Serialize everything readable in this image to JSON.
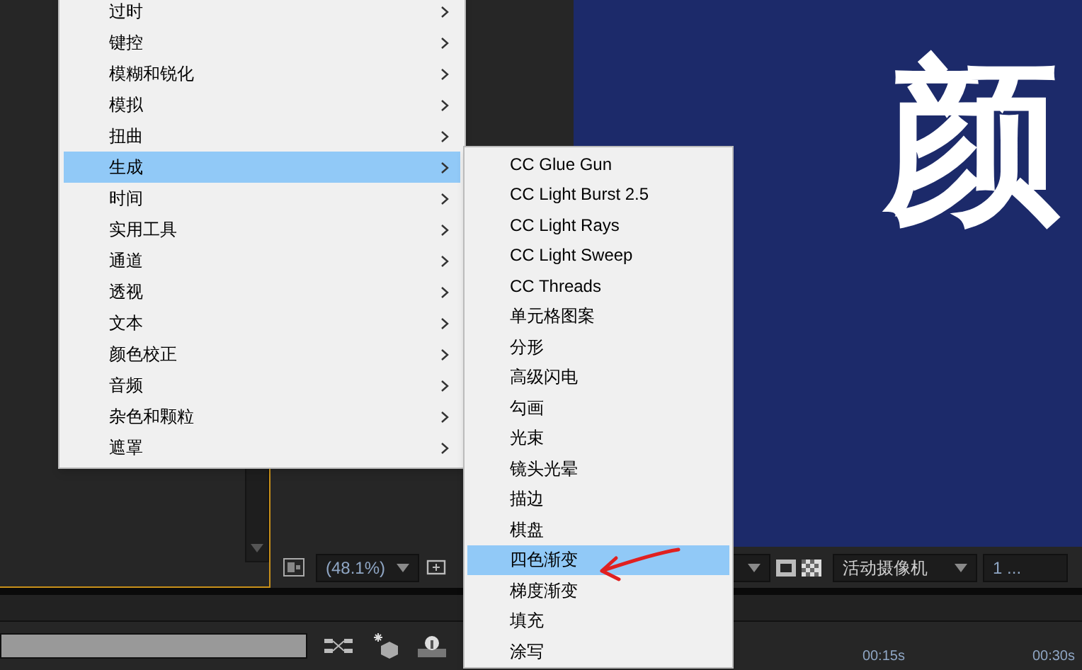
{
  "effects_menu": {
    "items": [
      {
        "label": "过时",
        "selected": false
      },
      {
        "label": "键控",
        "selected": false
      },
      {
        "label": "模糊和锐化",
        "selected": false
      },
      {
        "label": "模拟",
        "selected": false
      },
      {
        "label": "扭曲",
        "selected": false
      },
      {
        "label": "生成",
        "selected": true
      },
      {
        "label": "时间",
        "selected": false
      },
      {
        "label": "实用工具",
        "selected": false
      },
      {
        "label": "通道",
        "selected": false
      },
      {
        "label": "透视",
        "selected": false
      },
      {
        "label": "文本",
        "selected": false
      },
      {
        "label": "颜色校正",
        "selected": false
      },
      {
        "label": "音频",
        "selected": false
      },
      {
        "label": "杂色和颗粒",
        "selected": false
      },
      {
        "label": "遮罩",
        "selected": false
      }
    ]
  },
  "generate_submenu": {
    "items": [
      {
        "label": "CC Glue Gun",
        "selected": false
      },
      {
        "label": "CC Light Burst 2.5",
        "selected": false
      },
      {
        "label": "CC Light Rays",
        "selected": false
      },
      {
        "label": "CC Light Sweep",
        "selected": false
      },
      {
        "label": "CC Threads",
        "selected": false
      },
      {
        "label": "单元格图案",
        "selected": false
      },
      {
        "label": "分形",
        "selected": false
      },
      {
        "label": "高级闪电",
        "selected": false
      },
      {
        "label": "勾画",
        "selected": false
      },
      {
        "label": "光束",
        "selected": false
      },
      {
        "label": "镜头光晕",
        "selected": false
      },
      {
        "label": "描边",
        "selected": false
      },
      {
        "label": "棋盘",
        "selected": false
      },
      {
        "label": "四色渐变",
        "selected": true
      },
      {
        "label": "梯度渐变",
        "selected": false
      },
      {
        "label": "填充",
        "selected": false
      },
      {
        "label": "涂写",
        "selected": false
      }
    ]
  },
  "composition": {
    "text": "颜"
  },
  "viewer_toolbar": {
    "zoom": "(48.1%)",
    "camera": "活动摄像机",
    "view": "1 ..."
  },
  "timeline": {
    "ruler_labels": [
      "00:15s",
      "00:30s"
    ]
  }
}
